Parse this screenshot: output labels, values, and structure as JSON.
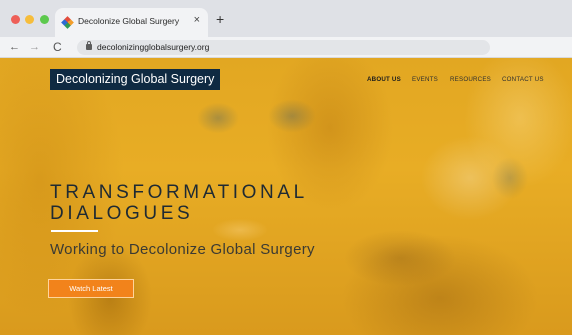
{
  "browser": {
    "tab_title": "Decolonize Global Surgery",
    "tab_close": "×",
    "new_tab": "+",
    "url": "decolonizingglobalsurgery.org",
    "back": "←",
    "forward": "→",
    "reload": "C"
  },
  "site": {
    "brand": "Decolonizing Global Surgery",
    "nav": [
      "ABOUT US",
      "EVENTS",
      "RESOURCES",
      "CONTACT US"
    ],
    "hero": {
      "title_line1": "TRANSFORMATIONAL",
      "title_line2": "DIALOGUES",
      "subtitle": "Working to Decolonize Global Surgery",
      "button": "Watch Latest"
    }
  },
  "colors": {
    "overlay": "#e8ad25",
    "brand_bg": "#0f2a42",
    "button": "#f2831b"
  }
}
